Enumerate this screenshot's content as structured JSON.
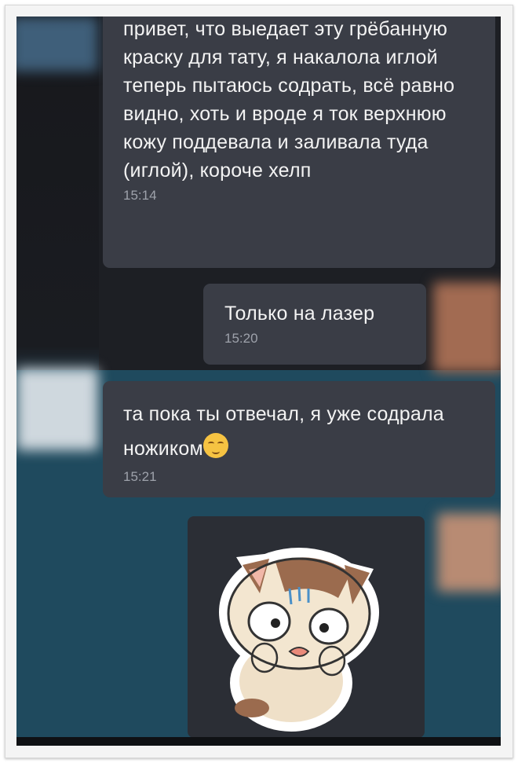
{
  "messages": [
    {
      "text": "привет, что выедает эту грёбанную краску для тату, я накалола иглой теперь пытаюсь содрать, всё равно видно, хоть и вроде я ток верхнюю кожу поддевала и заливала туда (иглой), короче хелп",
      "time": "15:14",
      "direction": "incoming"
    },
    {
      "text": "Только на лазер",
      "time": "15:20",
      "direction": "outgoing"
    },
    {
      "text": "та пока ты отвечал, я уже содрала ножиком",
      "emoji": "relieved-face",
      "time": "15:21",
      "direction": "incoming"
    },
    {
      "type": "sticker",
      "sticker": "scared-cat-sticker",
      "direction": "outgoing"
    }
  ],
  "colors": {
    "bubble": "#3a3d46",
    "text": "#f3f3f3",
    "time": "#9ea2ab",
    "chat_background": "#1f4a5e"
  }
}
